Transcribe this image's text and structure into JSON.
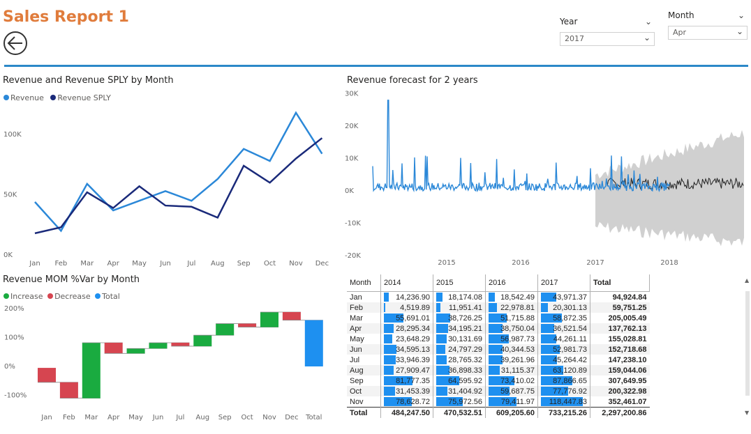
{
  "header": {
    "title": "Sales Report 1"
  },
  "filters": {
    "year": {
      "label": "Year",
      "value": "2017"
    },
    "month": {
      "label": "Month",
      "value": "Apr"
    }
  },
  "colors": {
    "revenue": "#2B88D8",
    "sply": "#1A2A7A",
    "increase": "#1AAB40",
    "decrease": "#D64550",
    "total": "#1E90F0",
    "forecast_band": "#d0d0d0",
    "forecast_line": "#222222"
  },
  "line_chart_title": "Revenue and Revenue SPLY by Month",
  "forecast_title": "Revenue forecast for 2 years",
  "waterfall_title": "Revenue MOM %Var by Month",
  "chart_data": [
    {
      "type": "line",
      "categories": [
        "Jan",
        "Feb",
        "Mar",
        "Apr",
        "May",
        "Jun",
        "Jul",
        "Aug",
        "Sep",
        "Oct",
        "Nov",
        "Dec"
      ],
      "series": [
        {
          "name": "Revenue",
          "values": [
            44000,
            20000,
            59000,
            37000,
            45000,
            53000,
            45000,
            63000,
            88000,
            78000,
            118000,
            84000
          ]
        },
        {
          "name": "Revenue SPLY",
          "values": [
            18000,
            23000,
            52000,
            39000,
            57000,
            41000,
            40000,
            31000,
            74000,
            60000,
            80000,
            97000
          ]
        }
      ],
      "yticks": [
        "0K",
        "50K",
        "100K"
      ],
      "ylim": [
        0,
        125000
      ],
      "legend_position": "top-left"
    },
    {
      "type": "line",
      "x_ticks": [
        "2015",
        "2016",
        "2017",
        "2018"
      ],
      "yticks": [
        "-20K",
        "-10K",
        "0K",
        "10K",
        "20K",
        "30K"
      ],
      "ylim": [
        -20000,
        30000
      ],
      "series": [
        {
          "name": "actual",
          "note": "daily revenue 2014 to early 2018",
          "peak": 28000
        },
        {
          "name": "forecast",
          "range": [
            "2017-06",
            "2018-12"
          ]
        }
      ]
    },
    {
      "type": "waterfall",
      "categories": [
        "Jan",
        "Feb",
        "Mar",
        "Apr",
        "May",
        "Jun",
        "Jul",
        "Aug",
        "Sep",
        "Oct",
        "Nov",
        "Dec",
        "Total"
      ],
      "steps": [
        {
          "start": -5,
          "end": -55,
          "kind": "decrease"
        },
        {
          "start": -55,
          "end": -110,
          "kind": "decrease"
        },
        {
          "start": -110,
          "end": 82,
          "kind": "increase"
        },
        {
          "start": 82,
          "end": 45,
          "kind": "decrease"
        },
        {
          "start": 45,
          "end": 62,
          "kind": "increase"
        },
        {
          "start": 62,
          "end": 82,
          "kind": "increase"
        },
        {
          "start": 82,
          "end": 70,
          "kind": "decrease"
        },
        {
          "start": 70,
          "end": 108,
          "kind": "increase"
        },
        {
          "start": 108,
          "end": 148,
          "kind": "increase"
        },
        {
          "start": 148,
          "end": 136,
          "kind": "decrease"
        },
        {
          "start": 136,
          "end": 188,
          "kind": "increase"
        },
        {
          "start": 188,
          "end": 160,
          "kind": "decrease"
        },
        {
          "start": 0,
          "end": 160,
          "kind": "total"
        }
      ],
      "yticks": [
        "-100%",
        "0%",
        "100%",
        "200%"
      ],
      "ylim": [
        -130,
        210
      ],
      "legend": [
        "Increase",
        "Decrease",
        "Total"
      ]
    }
  ],
  "matrix": {
    "headers": [
      "Month",
      "2014",
      "2015",
      "2016",
      "2017",
      "Total"
    ],
    "rows": [
      {
        "m": "Jan",
        "v": [
          "14,236.90",
          "18,174.08",
          "18,542.49",
          "43,971.37"
        ],
        "n": [
          14236.9,
          18174.08,
          18542.49,
          43971.37
        ],
        "t": "94,924.84"
      },
      {
        "m": "Feb",
        "v": [
          "4,519.89",
          "11,951.41",
          "22,978.81",
          "20,301.13"
        ],
        "n": [
          4519.89,
          11951.41,
          22978.81,
          20301.13
        ],
        "t": "59,751.25"
      },
      {
        "m": "Mar",
        "v": [
          "55,691.01",
          "38,726.25",
          "51,715.88",
          "58,872.35"
        ],
        "n": [
          55691.01,
          38726.25,
          51715.88,
          58872.35
        ],
        "t": "205,005.49"
      },
      {
        "m": "Apr",
        "v": [
          "28,295.34",
          "34,195.21",
          "38,750.04",
          "36,521.54"
        ],
        "n": [
          28295.34,
          34195.21,
          38750.04,
          36521.54
        ],
        "t": "137,762.13"
      },
      {
        "m": "May",
        "v": [
          "23,648.29",
          "30,131.69",
          "56,987.73",
          "44,261.11"
        ],
        "n": [
          23648.29,
          30131.69,
          56987.73,
          44261.11
        ],
        "t": "155,028.81"
      },
      {
        "m": "Jun",
        "v": [
          "34,595.13",
          "24,797.29",
          "40,344.53",
          "52,981.73"
        ],
        "n": [
          34595.13,
          24797.29,
          40344.53,
          52981.73
        ],
        "t": "152,718.68"
      },
      {
        "m": "Jul",
        "v": [
          "33,946.39",
          "28,765.32",
          "39,261.96",
          "45,264.42"
        ],
        "n": [
          33946.39,
          28765.32,
          39261.96,
          45264.42
        ],
        "t": "147,238.10"
      },
      {
        "m": "Aug",
        "v": [
          "27,909.47",
          "36,898.33",
          "31,115.37",
          "63,120.89"
        ],
        "n": [
          27909.47,
          36898.33,
          31115.37,
          63120.89
        ],
        "t": "159,044.06"
      },
      {
        "m": "Sep",
        "v": [
          "81,777.35",
          "64,595.92",
          "73,410.02",
          "87,866.65"
        ],
        "n": [
          81777.35,
          64595.92,
          73410.02,
          87866.65
        ],
        "t": "307,649.95"
      },
      {
        "m": "Oct",
        "v": [
          "31,453.39",
          "31,404.92",
          "59,687.75",
          "77,776.92"
        ],
        "n": [
          31453.39,
          31404.92,
          59687.75,
          77776.92
        ],
        "t": "200,322.98"
      },
      {
        "m": "Nov",
        "v": [
          "78,628.72",
          "75,972.56",
          "79,411.97",
          "118,447.83"
        ],
        "n": [
          78628.72,
          75972.56,
          79411.97,
          118447.83
        ],
        "t": "352,461.07"
      }
    ],
    "total_row": {
      "m": "Total",
      "v": [
        "484,247.50",
        "470,532.51",
        "609,205.60",
        "733,215.26"
      ],
      "t": "2,297,200.86"
    }
  }
}
